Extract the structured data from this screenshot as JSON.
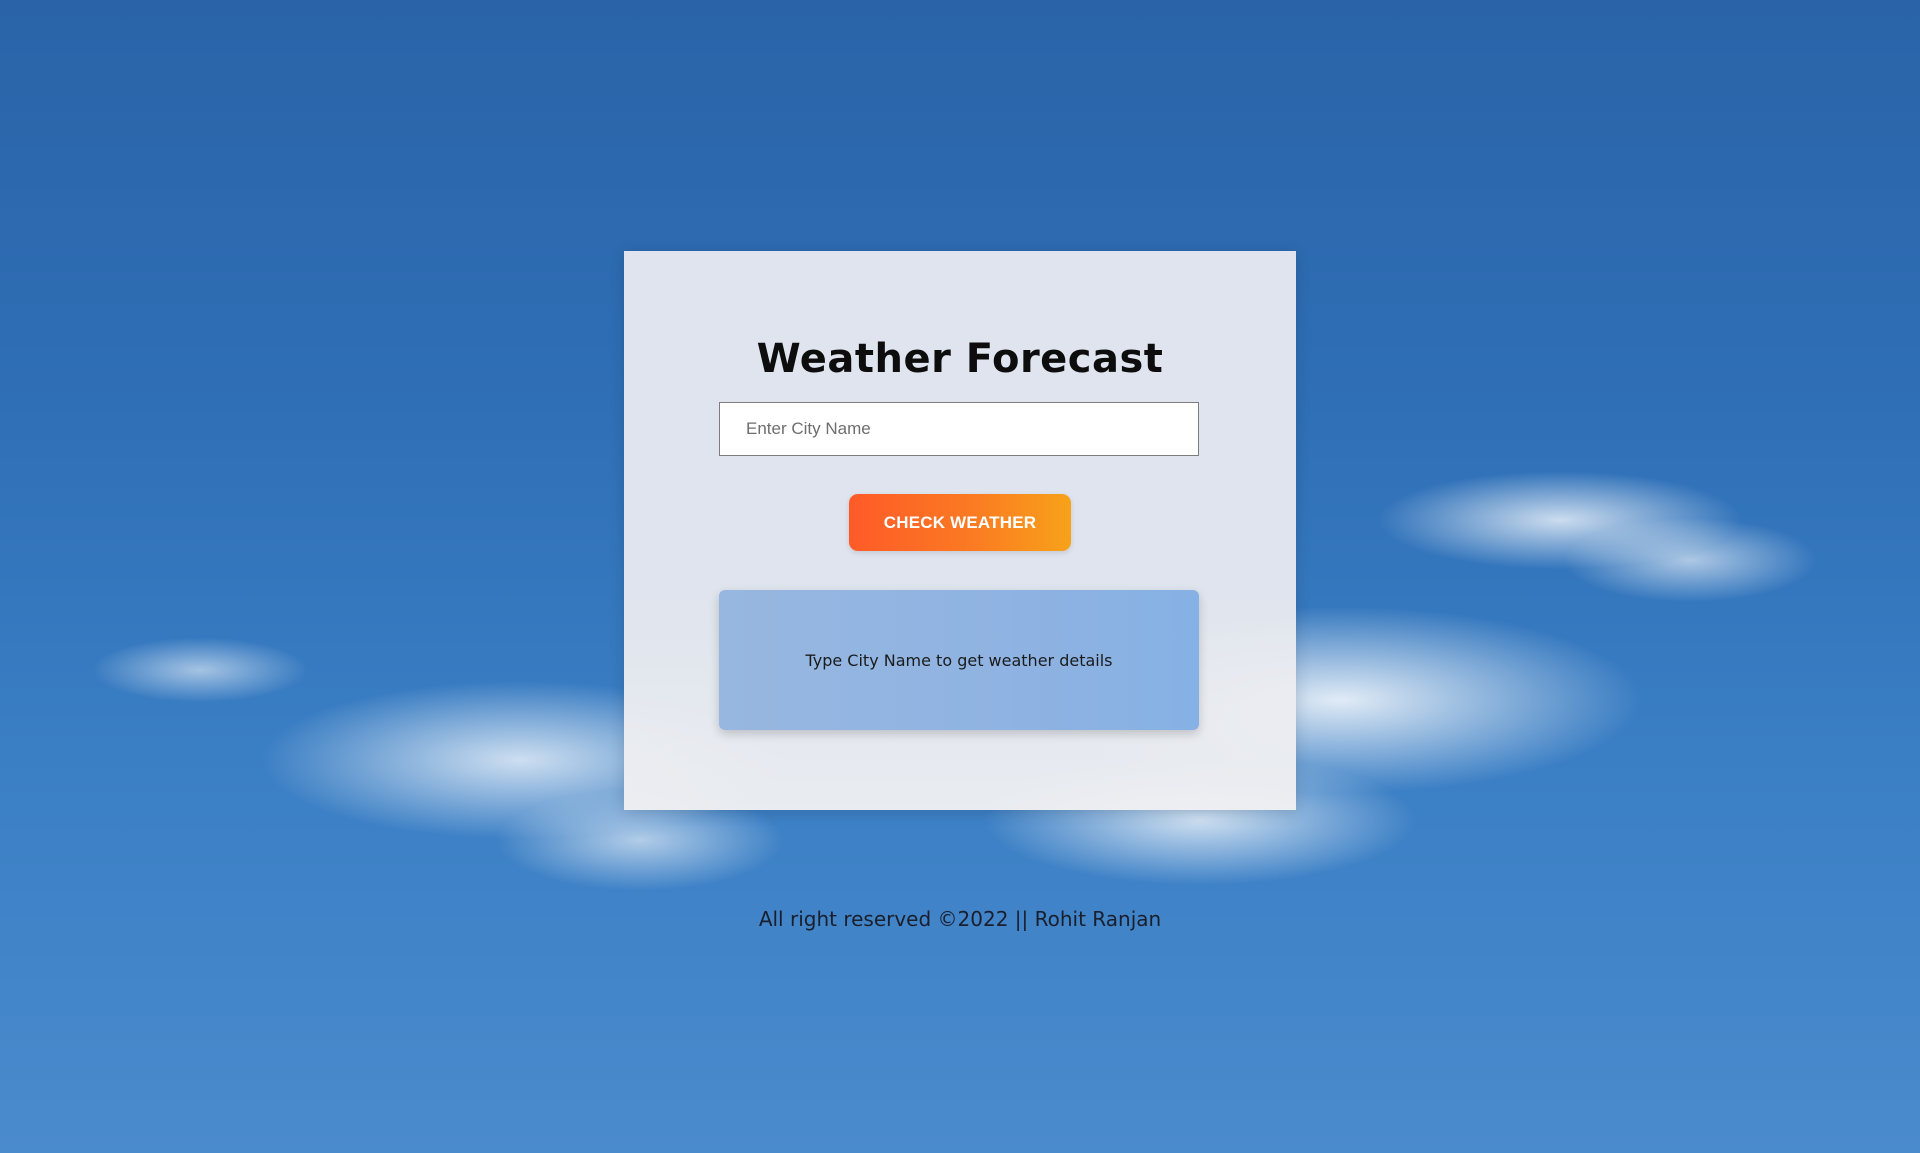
{
  "card": {
    "title": "Weather Forecast",
    "city_input": {
      "value": "",
      "placeholder": "Enter City Name"
    },
    "check_button_label": "CHECK WEATHER",
    "result_message": "Type City Name to get weather details"
  },
  "footer": {
    "text": "All right reserved ©2022 || Rohit Ranjan"
  },
  "colors": {
    "sky": "#2f6fb6",
    "button_gradient_start": "#fe5a28",
    "button_gradient_end": "#f7a21a",
    "result_box": "#8fb3e2",
    "card": "#e5e8f0"
  }
}
